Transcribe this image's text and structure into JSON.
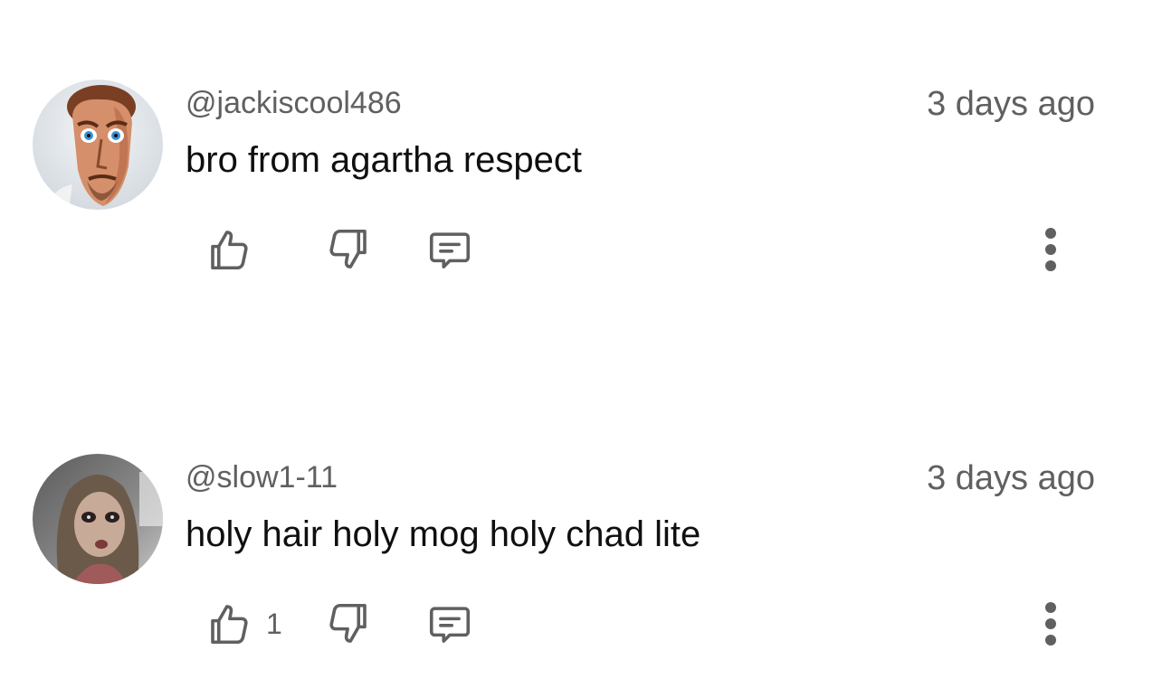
{
  "comments": [
    {
      "handle": "@jackiscool486",
      "timestamp": "3 days ago",
      "text": "bro from agartha respect",
      "like_count": "",
      "avatar_icon": "avatar-cartoon-man-icon"
    },
    {
      "handle": "@slow1-11",
      "timestamp": "3 days ago",
      "text": "holy hair holy mog holy chad lite",
      "like_count": "1",
      "avatar_icon": "avatar-woman-photo-icon"
    }
  ],
  "colors": {
    "primary_text": "#0f0f0f",
    "secondary_text": "#606060",
    "icon": "#606060",
    "background": "#ffffff"
  }
}
